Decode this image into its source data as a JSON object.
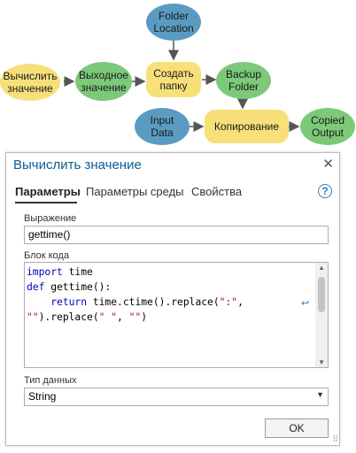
{
  "diagram": {
    "nodes": {
      "calc_value": "Вычислить\nзначение",
      "output_value": "Выходное\nзначение",
      "folder_location": "Folder\nLocation",
      "create_folder": "Создать\nпапку",
      "backup_folder": "Backup\nFolder",
      "input_data": "Input\nData",
      "copy": "Копирование",
      "copied_output": "Copied\nOutput"
    }
  },
  "dialog": {
    "title": "Вычислить значение",
    "close_glyph": "✕",
    "tabs": [
      "Параметры",
      "Параметры среды",
      "Свойства"
    ],
    "help_glyph": "?",
    "expression_label": "Выражение",
    "expression_value": "gettime()",
    "code_label": "Блок кода",
    "code": {
      "line1_kw": "import",
      "line1_rest": " time",
      "line2_kw": "def",
      "line2_rest": " gettime():",
      "line3_indent": "    ",
      "line3_kw": "return",
      "line3_rest": " time.ctime().replace(",
      "line3_str": "\":\"",
      "line3_end": ",",
      "line4_str1": "\"\"",
      "line4_mid": ").replace(",
      "line4_str2": "\" \"",
      "line4_sep": ", ",
      "line4_str3": "\"\"",
      "line4_end": ")"
    },
    "wrap_glyph": "↩",
    "datatype_label": "Тип данных",
    "datatype_value": "String",
    "ok_label": "OK"
  },
  "colors": {
    "variable_blue": "#5b9bc1",
    "output_green": "#7cc97a",
    "tool_yellow": "#f7e07a",
    "title_blue": "#0f5b94"
  },
  "icons": [
    "close-icon",
    "help-icon",
    "word-wrap-icon",
    "dropdown-arrow-icon",
    "resize-grip-icon"
  ]
}
